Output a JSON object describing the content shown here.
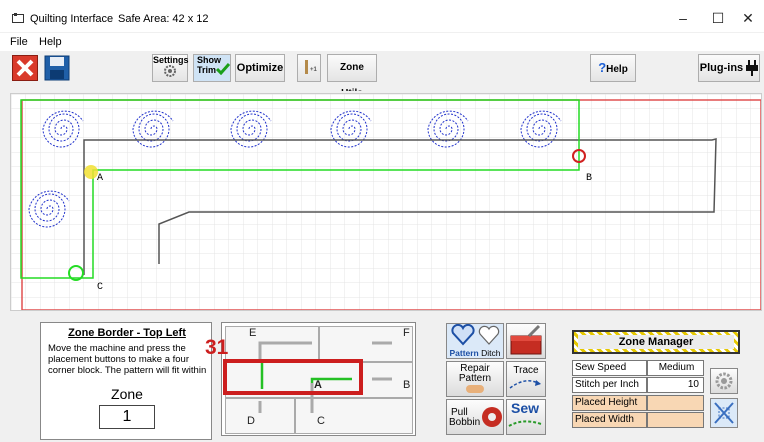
{
  "window": {
    "title": "Quilting Interface",
    "safe_area": "Safe Area:  42 x 12",
    "minimize": "–",
    "maximize": "☐",
    "close": "✕"
  },
  "menu": {
    "file": "File",
    "help": "Help"
  },
  "toolbar": {
    "settings_label": "Settings",
    "show_trim_line1": "Show",
    "show_trim_line2": "Trim",
    "optimize_label": "Optimize",
    "zone_utils_label": "Zone Utils",
    "help_label": "Help",
    "plugins_label": "Plug-ins"
  },
  "canvas": {
    "labels": {
      "a": "A",
      "b": "B",
      "c": "C"
    },
    "colors": {
      "outline": "#24dc24",
      "pattern": "#2233cc",
      "red_border": "#e05050",
      "path": "#555555"
    }
  },
  "zone_border": {
    "title": "Zone Border - Top Left",
    "description": "Move the machine and press the placement buttons to make a four corner block. The pattern will fit within the block.",
    "zone_label": "Zone",
    "zone_value": "1"
  },
  "zone_grid": {
    "labels": {
      "e": "E",
      "f": "F",
      "b": "B",
      "a": "A",
      "d": "D",
      "c": "C"
    },
    "overlay_number": "31"
  },
  "buttons": {
    "pattern": "Pattern",
    "ditch": "Ditch",
    "repair_line1": "Repair",
    "repair_line2": "Pattern",
    "trace": "Trace",
    "pull_line1": "Pull",
    "pull_line2": "Bobbin",
    "sew": "Sew"
  },
  "zone_manager": {
    "title": "Zone Manager",
    "sew_speed_label": "Sew Speed",
    "sew_speed_value": "Medium",
    "stitch_label": "Stitch per Inch",
    "stitch_value": "10",
    "placed_height_label": "Placed Height",
    "placed_width_label": "Placed Width"
  }
}
